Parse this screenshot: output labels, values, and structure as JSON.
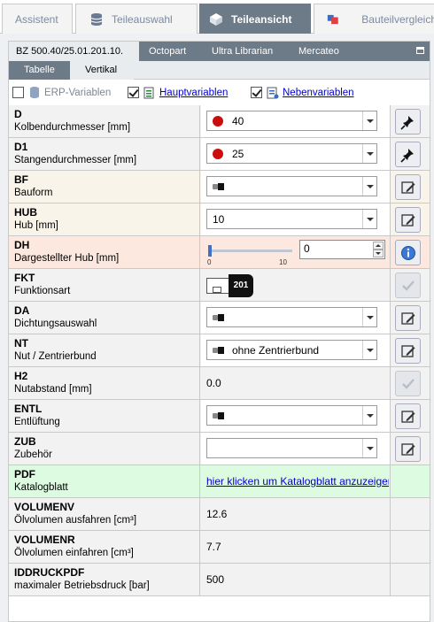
{
  "top_tabs": [
    {
      "label": "Assistent",
      "icon": "none"
    },
    {
      "label": "Teileauswahl",
      "icon": "database-icon"
    },
    {
      "label": "Teileansicht",
      "icon": "parts-view-icon"
    },
    {
      "label": "Bauteilvergleich",
      "icon": "compare-icon"
    }
  ],
  "sub_tabs": [
    "BZ 500.40/25.01.201.10.",
    "Octopart",
    "Ultra Librarian",
    "Mercateo"
  ],
  "view_tabs": [
    "Tabelle",
    "Vertikal"
  ],
  "checks": {
    "erp": {
      "label": "ERP-Variablen",
      "checked": false
    },
    "haupt": {
      "label": "Hauptvariablen",
      "checked": true
    },
    "neben": {
      "label": "Nebenvariablen",
      "checked": true
    }
  },
  "rows": [
    {
      "code": "D",
      "desc": "Kolbendurchmesser [mm]",
      "value": "40"
    },
    {
      "code": "D1",
      "desc": "Stangendurchmesser [mm]",
      "value": "25"
    },
    {
      "code": "BF",
      "desc": "Bauform",
      "value": ""
    },
    {
      "code": "HUB",
      "desc": "Hub [mm]",
      "value": "10"
    },
    {
      "code": "DH",
      "desc": "Dargestellter Hub [mm]",
      "value": "0",
      "slider_min": "0",
      "slider_max": "10",
      "slider_value": 0
    },
    {
      "code": "FKT",
      "desc": "Funktionsart",
      "value": "201"
    },
    {
      "code": "DA",
      "desc": "Dichtungsauswahl",
      "value": ""
    },
    {
      "code": "NT",
      "desc": "Nut / Zentrierbund",
      "value": "ohne Zentrierbund"
    },
    {
      "code": "H2",
      "desc": "Nutabstand [mm]",
      "value": "0.0"
    },
    {
      "code": "ENTL",
      "desc": "Entlüftung",
      "value": ""
    },
    {
      "code": "ZUB",
      "desc": "Zubehör",
      "value": ""
    },
    {
      "code": "PDF",
      "desc": "Katalogblatt",
      "value": "hier klicken um Katalogblatt anzuzeigen"
    },
    {
      "code": "VOLUMENV",
      "desc": "Ölvolumen ausfahren [cm³]",
      "value": "12.6"
    },
    {
      "code": "VOLUMENR",
      "desc": "Ölvolumen einfahren [cm³]",
      "value": "7.7"
    },
    {
      "code": "IDDRUCKPDF",
      "desc": "maximaler Betriebsdruck [bar]",
      "value": "500"
    }
  ],
  "colors": {
    "tab_active": "#6d7a87",
    "row_grey": "#f2f2f2",
    "row_beige": "#f8f4ea",
    "row_peach": "#fce8df",
    "row_green": "#dcfbe1",
    "dot_red": "#cc0d0d",
    "link_blue": "#0000cc"
  }
}
